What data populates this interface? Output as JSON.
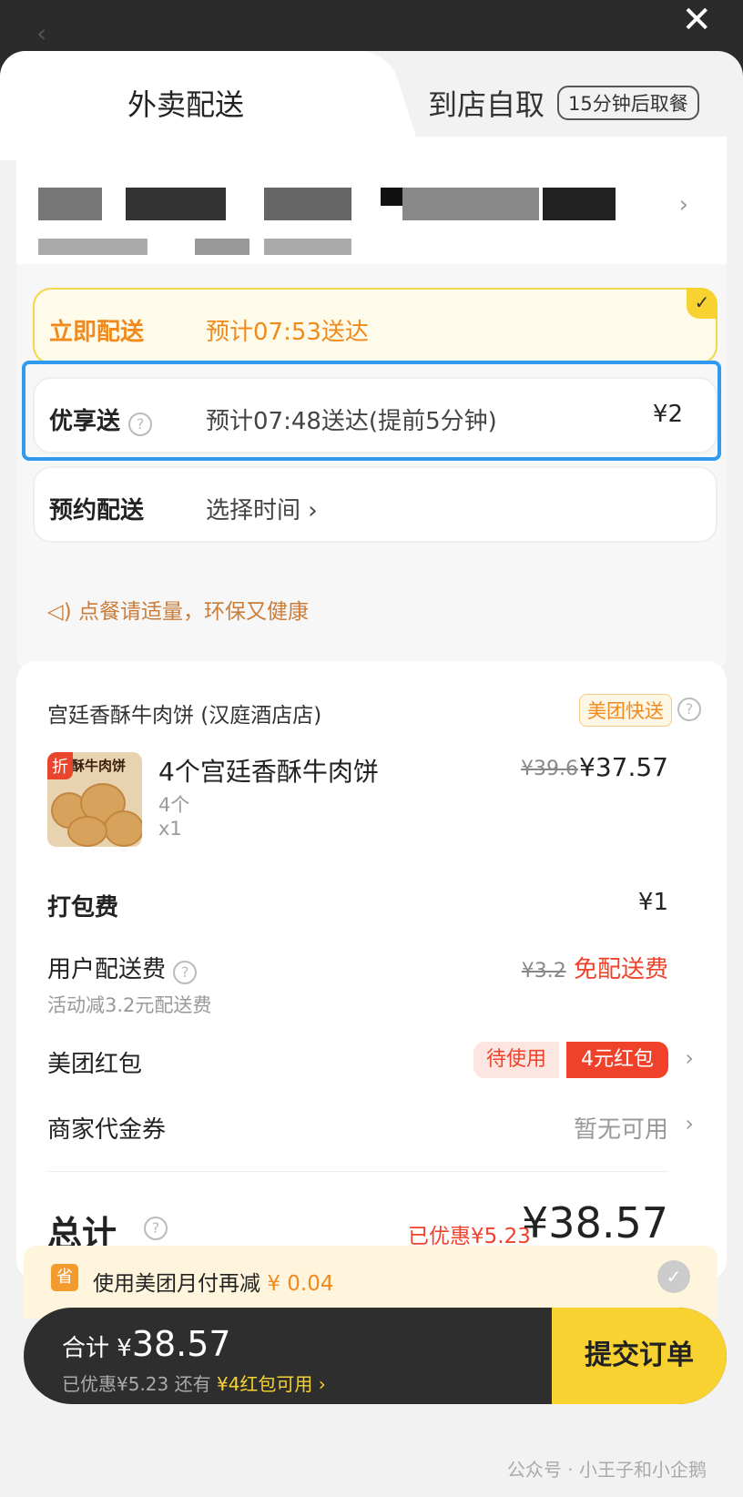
{
  "tabs": {
    "delivery": "外卖配送",
    "pickup": "到店自取",
    "pickup_badge": "15分钟后取餐"
  },
  "delivery_options": [
    {
      "name": "立即配送",
      "desc": "预计07:53送达",
      "price": ""
    },
    {
      "name": "优享送",
      "desc": "预计07:48送达(提前5分钟)",
      "price": "¥2"
    },
    {
      "name": "预约配送",
      "desc": "选择时间 ›",
      "price": ""
    }
  ],
  "tip": "点餐请适量，环保又健康",
  "order": {
    "shop": "宫廷香酥牛肉饼 (汉庭酒店店)",
    "badge": "美团快送",
    "item": {
      "tag": "折",
      "thumb_text": "酥牛肉饼",
      "name": "4个宫廷香酥牛肉饼",
      "spec": "4个",
      "qty": "x1",
      "old_price": "¥39.6",
      "price": "¥37.57"
    },
    "packing": {
      "label": "打包费",
      "value": "¥1"
    },
    "delivery_fee": {
      "label": "用户配送费",
      "old": "¥3.2",
      "value": "免配送费",
      "sub": "活动减3.2元配送费"
    },
    "redpacket": {
      "label": "美团红包",
      "wait": "待使用",
      "value": "4元红包"
    },
    "voucher": {
      "label": "商家代金券",
      "value": "暂无可用"
    },
    "total": {
      "label": "总计",
      "saved": "已优惠¥5.23",
      "value": "¥38.57"
    }
  },
  "promo": {
    "icon": "省",
    "text": "使用美团月付再减",
    "amount": "¥ 0.04"
  },
  "bar": {
    "sum_label": "合计 ¥",
    "sum": "38.57",
    "saved": "已优惠¥5.23 还有",
    "redpacket": "¥4红包可用 ›",
    "submit": "提交订单"
  },
  "watermark": "公众号 · 小王子和小企鹅"
}
